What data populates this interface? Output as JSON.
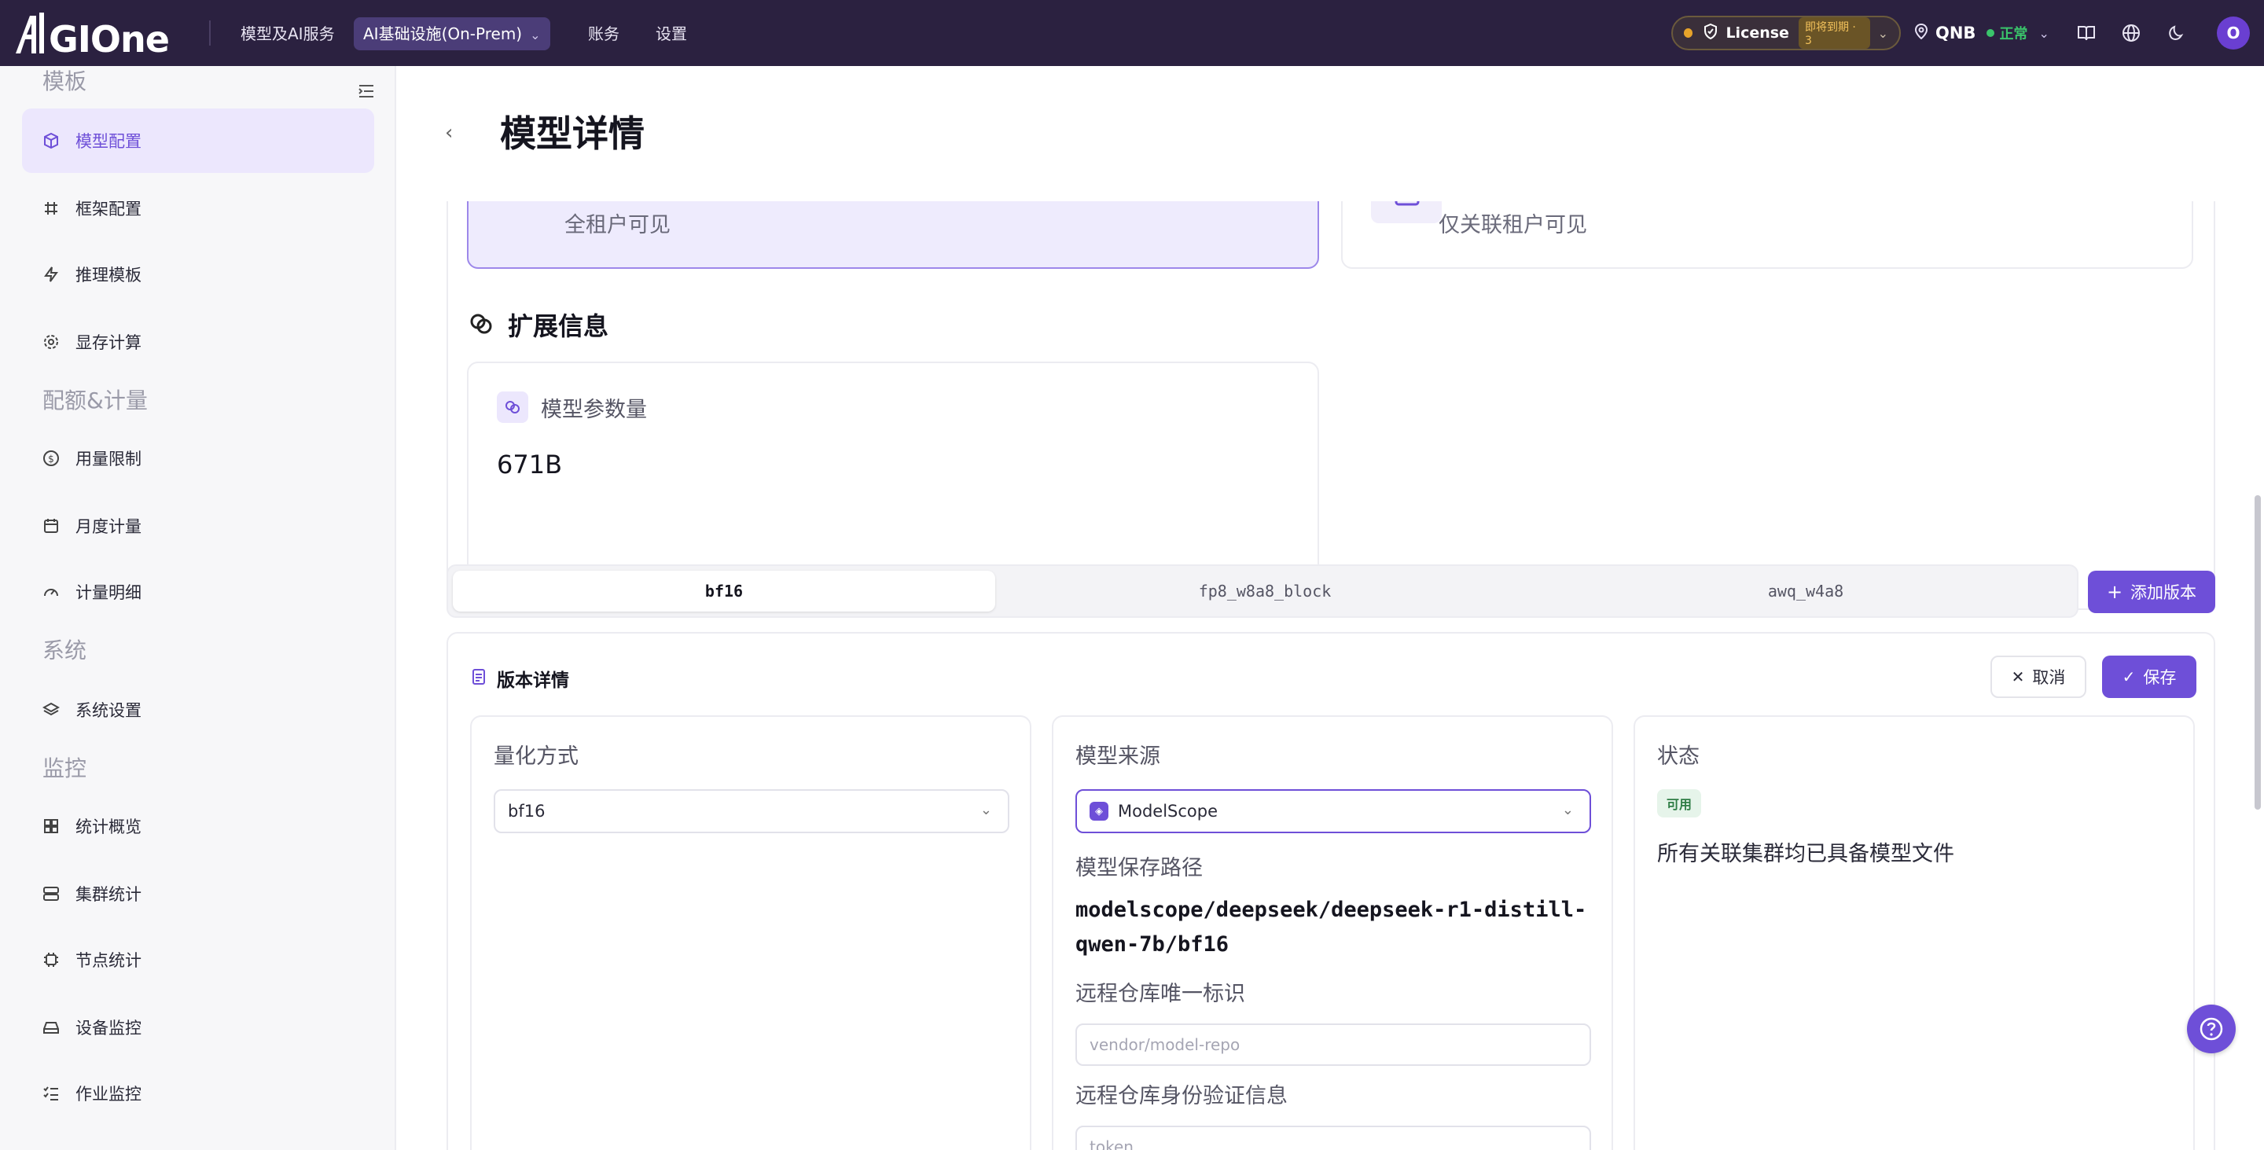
{
  "topbar": {
    "logo_text": "AIGIONE",
    "nav": [
      {
        "label": "模型及AI服务"
      },
      {
        "label": "AI基础设施(On-Prem)"
      },
      {
        "label": "账务"
      },
      {
        "label": "设置"
      }
    ],
    "license_label": "License",
    "license_badge": "即将到期 · 3",
    "region": "QNB",
    "region_status": "正常",
    "avatar": "O"
  },
  "sidebar": {
    "sections": [
      {
        "title": "模板",
        "items": [
          "模型配置",
          "框架配置",
          "推理模板",
          "显存计算"
        ]
      },
      {
        "title": "配额&计量",
        "items": [
          "用量限制",
          "月度计量",
          "计量明细"
        ]
      },
      {
        "title": "系统",
        "items": [
          "系统设置"
        ]
      },
      {
        "title": "监控",
        "items": [
          "统计概览",
          "集群统计",
          "节点统计",
          "设备监控",
          "作业监控"
        ]
      }
    ]
  },
  "page": {
    "title": "模型详情",
    "visibility": {
      "all": "全租户可见",
      "linked": "仅关联租户可见"
    },
    "extension": {
      "title": "扩展信息",
      "param_label": "模型参数量",
      "param_value": "671B"
    },
    "tabs": [
      "bf16",
      "fp8_w8a8_block",
      "awq_w4a8"
    ],
    "add_version": "添加版本",
    "version": {
      "title": "版本详情",
      "cancel": "取消",
      "save": "保存",
      "quant_label": "量化方式",
      "quant_value": "bf16",
      "source_label": "模型来源",
      "source_value": "ModelScope",
      "path_label": "模型保存路径",
      "path_value": "modelscope/deepseek/deepseek-r1-distill-qwen-7b/bf16",
      "repo_label": "远程仓库唯一标识",
      "repo_placeholder": "vendor/model-repo",
      "auth_label": "远程仓库身份验证信息",
      "auth_placeholder": "token",
      "status_label": "状态",
      "status_badge": "可用",
      "status_text": "所有关联集群均已具备模型文件"
    }
  },
  "help_icon": "question-icon"
}
